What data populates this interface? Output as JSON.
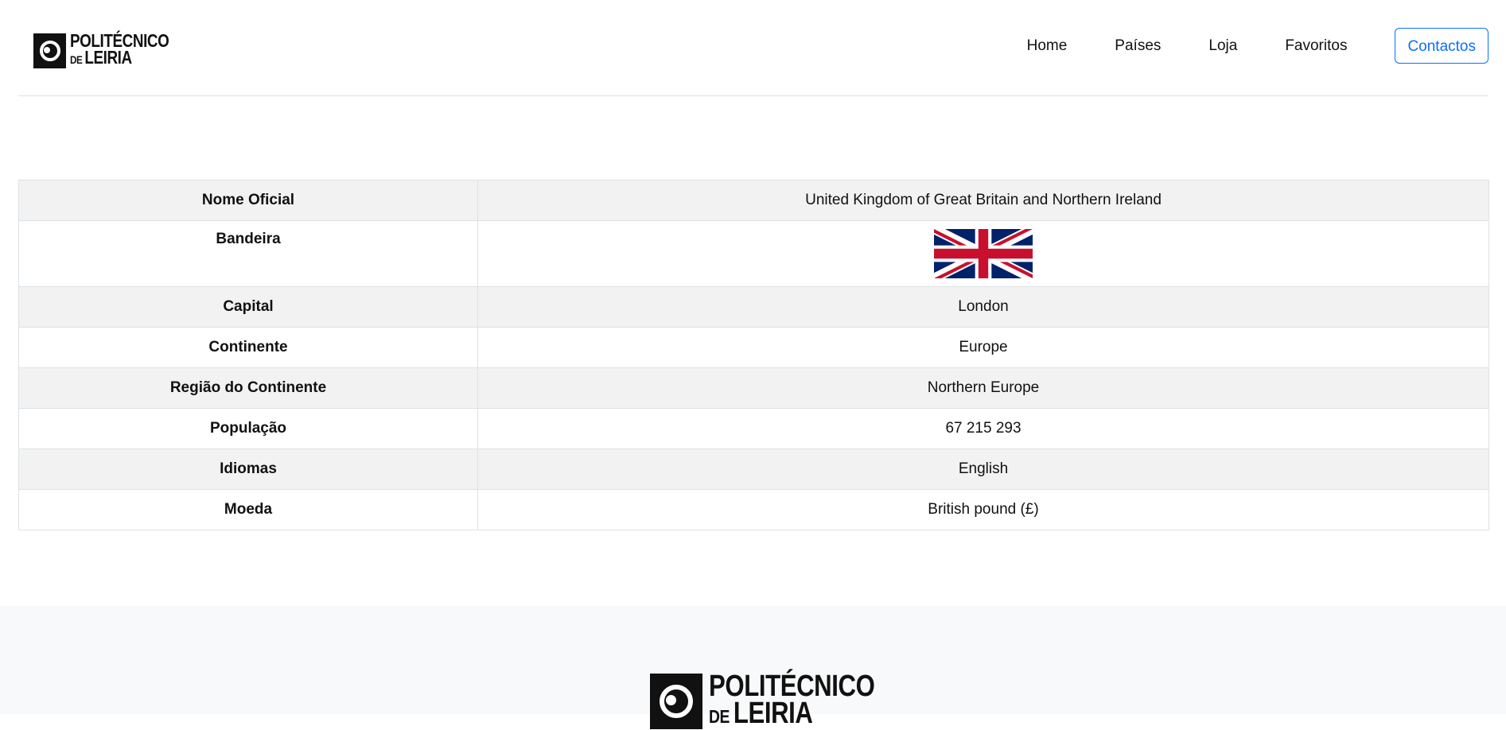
{
  "header": {
    "logo": {
      "line1": "POLITÉCNICO",
      "line2_small": "DE",
      "line2": "LEIRIA"
    },
    "nav": [
      {
        "label": "Home"
      },
      {
        "label": "Países"
      },
      {
        "label": "Loja"
      },
      {
        "label": "Favoritos"
      }
    ],
    "contact_label": "Contactos"
  },
  "country": {
    "rows": [
      {
        "key": "Nome Oficial",
        "value": "United Kingdom of Great Britain and Northern Ireland"
      },
      {
        "key": "Bandeira",
        "value": ""
      },
      {
        "key": "Capital",
        "value": "London"
      },
      {
        "key": "Continente",
        "value": "Europe"
      },
      {
        "key": "Região do Continente",
        "value": "Northern Europe"
      },
      {
        "key": "População",
        "value": "67 215 293"
      },
      {
        "key": "Idiomas",
        "value": "English"
      },
      {
        "key": "Moeda",
        "value": "British pound (£)"
      }
    ],
    "flag_icon": "union-jack-flag",
    "colors": {
      "flag_blue": "#012169",
      "flag_red": "#C8102E",
      "stripe": "#f2f2f2",
      "accent": "#0d6efd"
    }
  },
  "footer": {
    "logo": {
      "line1": "POLITÉCNICO",
      "line2_small": "DE",
      "line2": "LEIRIA"
    }
  }
}
